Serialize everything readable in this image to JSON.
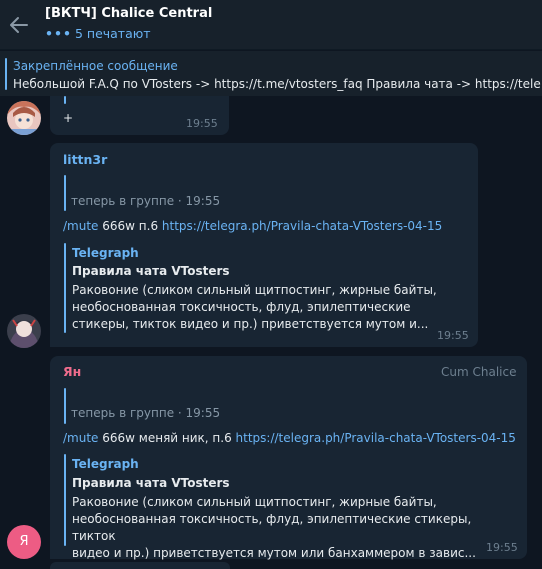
{
  "header": {
    "title": "[ВКТЧ] Chalice Central",
    "typing": "5 печатают"
  },
  "pinned": {
    "title": "Закреплённое сообщение",
    "text": "Небольшой F.A.Q по VTosters -> https://t.me/vtosters_faq Правила чата -> https://tele"
  },
  "messages": [
    {
      "text": "+",
      "time": "19:55"
    },
    {
      "sender": "littn3r",
      "sender_color": "#6ab3f3",
      "quote": "теперь в группе · 19:55",
      "command": "/mute",
      "text_mid": " 666w п.6 ",
      "link": "https://telegra.ph/Pravila-chata-VTosters-04-15",
      "preview": {
        "site": "Telegraph",
        "title": "Правила чата VTosters",
        "lines": [
          "Раковоние (сликом сильный щитпостинг, жирные байты,",
          "необоснованная токсичность, флуд, эпилептические",
          "стикеры, тикток видео и пр.) приветствуется мутом и..."
        ]
      },
      "time": "19:55"
    },
    {
      "sender": "Ян",
      "sender_color": "#ee6c8c",
      "badge": "Cum Chalice",
      "avatar_letter": "Я",
      "quote": "теперь в группе · 19:55",
      "command": "/mute",
      "text_mid": " 666w меняй ник, п.6 ",
      "link": "https://telegra.ph/Pravila-chata-VTosters-04-15",
      "preview": {
        "site": "Telegraph",
        "title": "Правила чата VTosters",
        "lines": [
          "Раковоние (сликом сильный щитпостинг, жирные байты,",
          "необоснованная токсичность, флуд, эпилептические стикеры, тикток",
          "видео и пр.) приветствуется мутом или банхаммером в завис..."
        ]
      },
      "time": "19:55"
    }
  ]
}
